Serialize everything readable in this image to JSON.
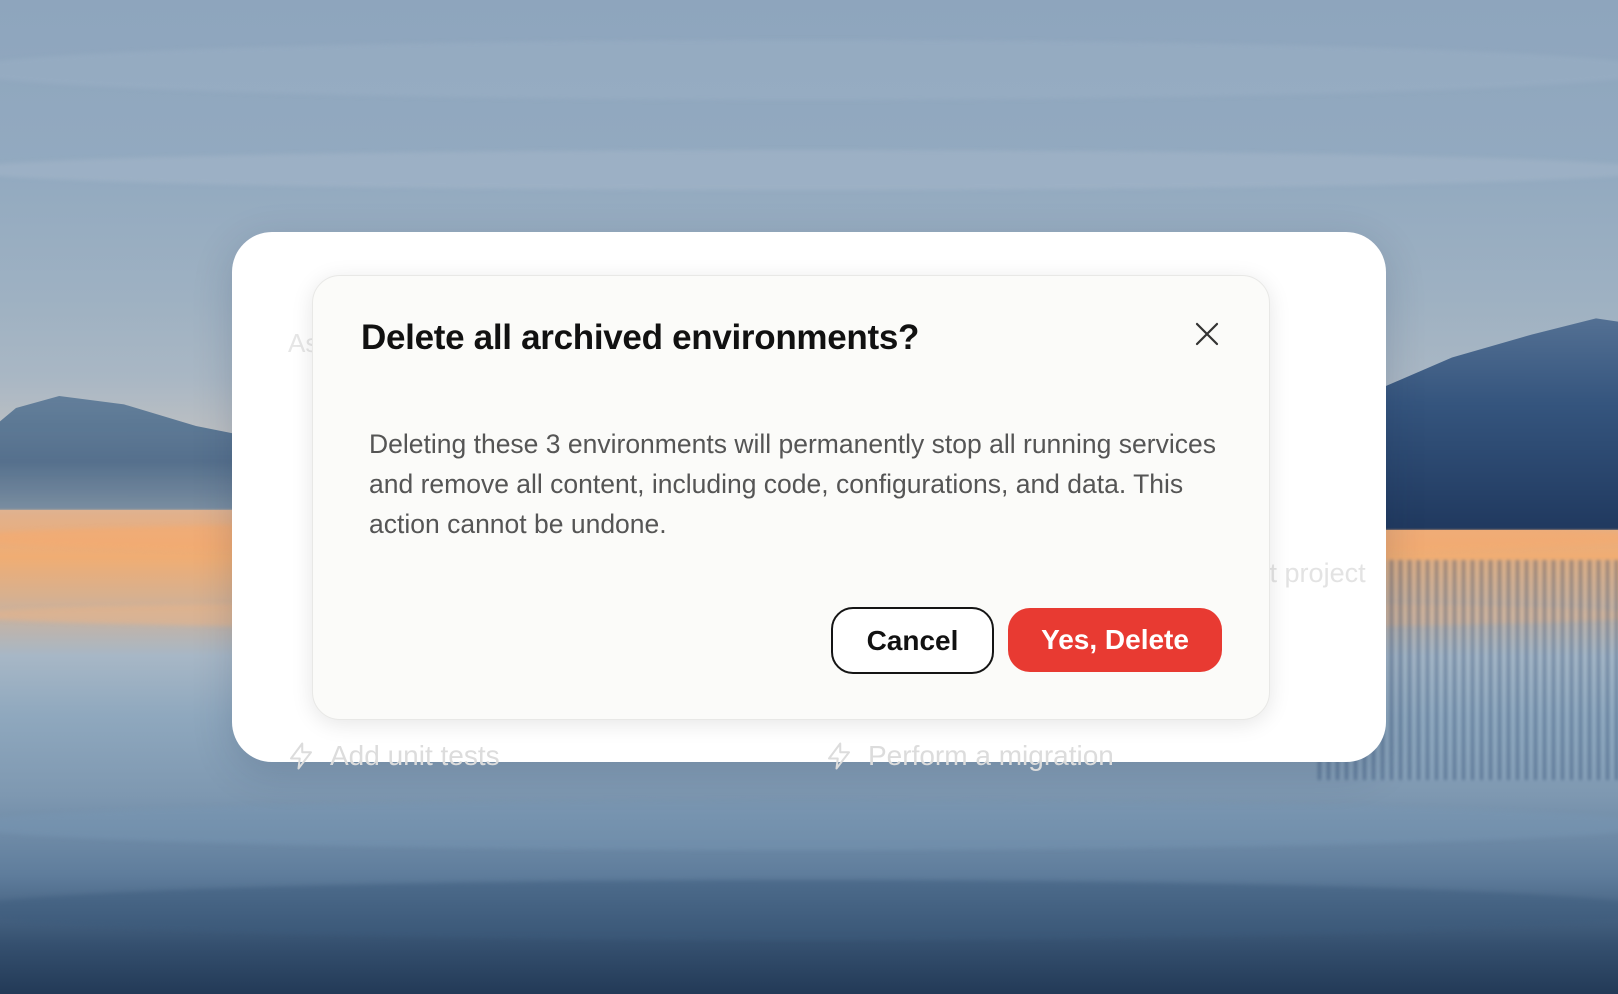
{
  "dialog": {
    "title": "Delete all archived environments?",
    "message": "Deleting these 3 environments will permanently stop all running services and remove all content, including code, configurations, and data. This action cannot be undone.",
    "cancel_label": "Cancel",
    "confirm_label": "Yes, Delete",
    "close_icon": "close-icon",
    "confirm_color": "#E83A32"
  },
  "background_panel": {
    "prompt_placeholder": "Ask",
    "project_select_placeholder": "Select project",
    "suggestions": [
      {
        "icon": "lightning-icon",
        "label": "Add unit tests"
      },
      {
        "icon": "lightning-icon",
        "label": "Perform a migration"
      }
    ]
  }
}
